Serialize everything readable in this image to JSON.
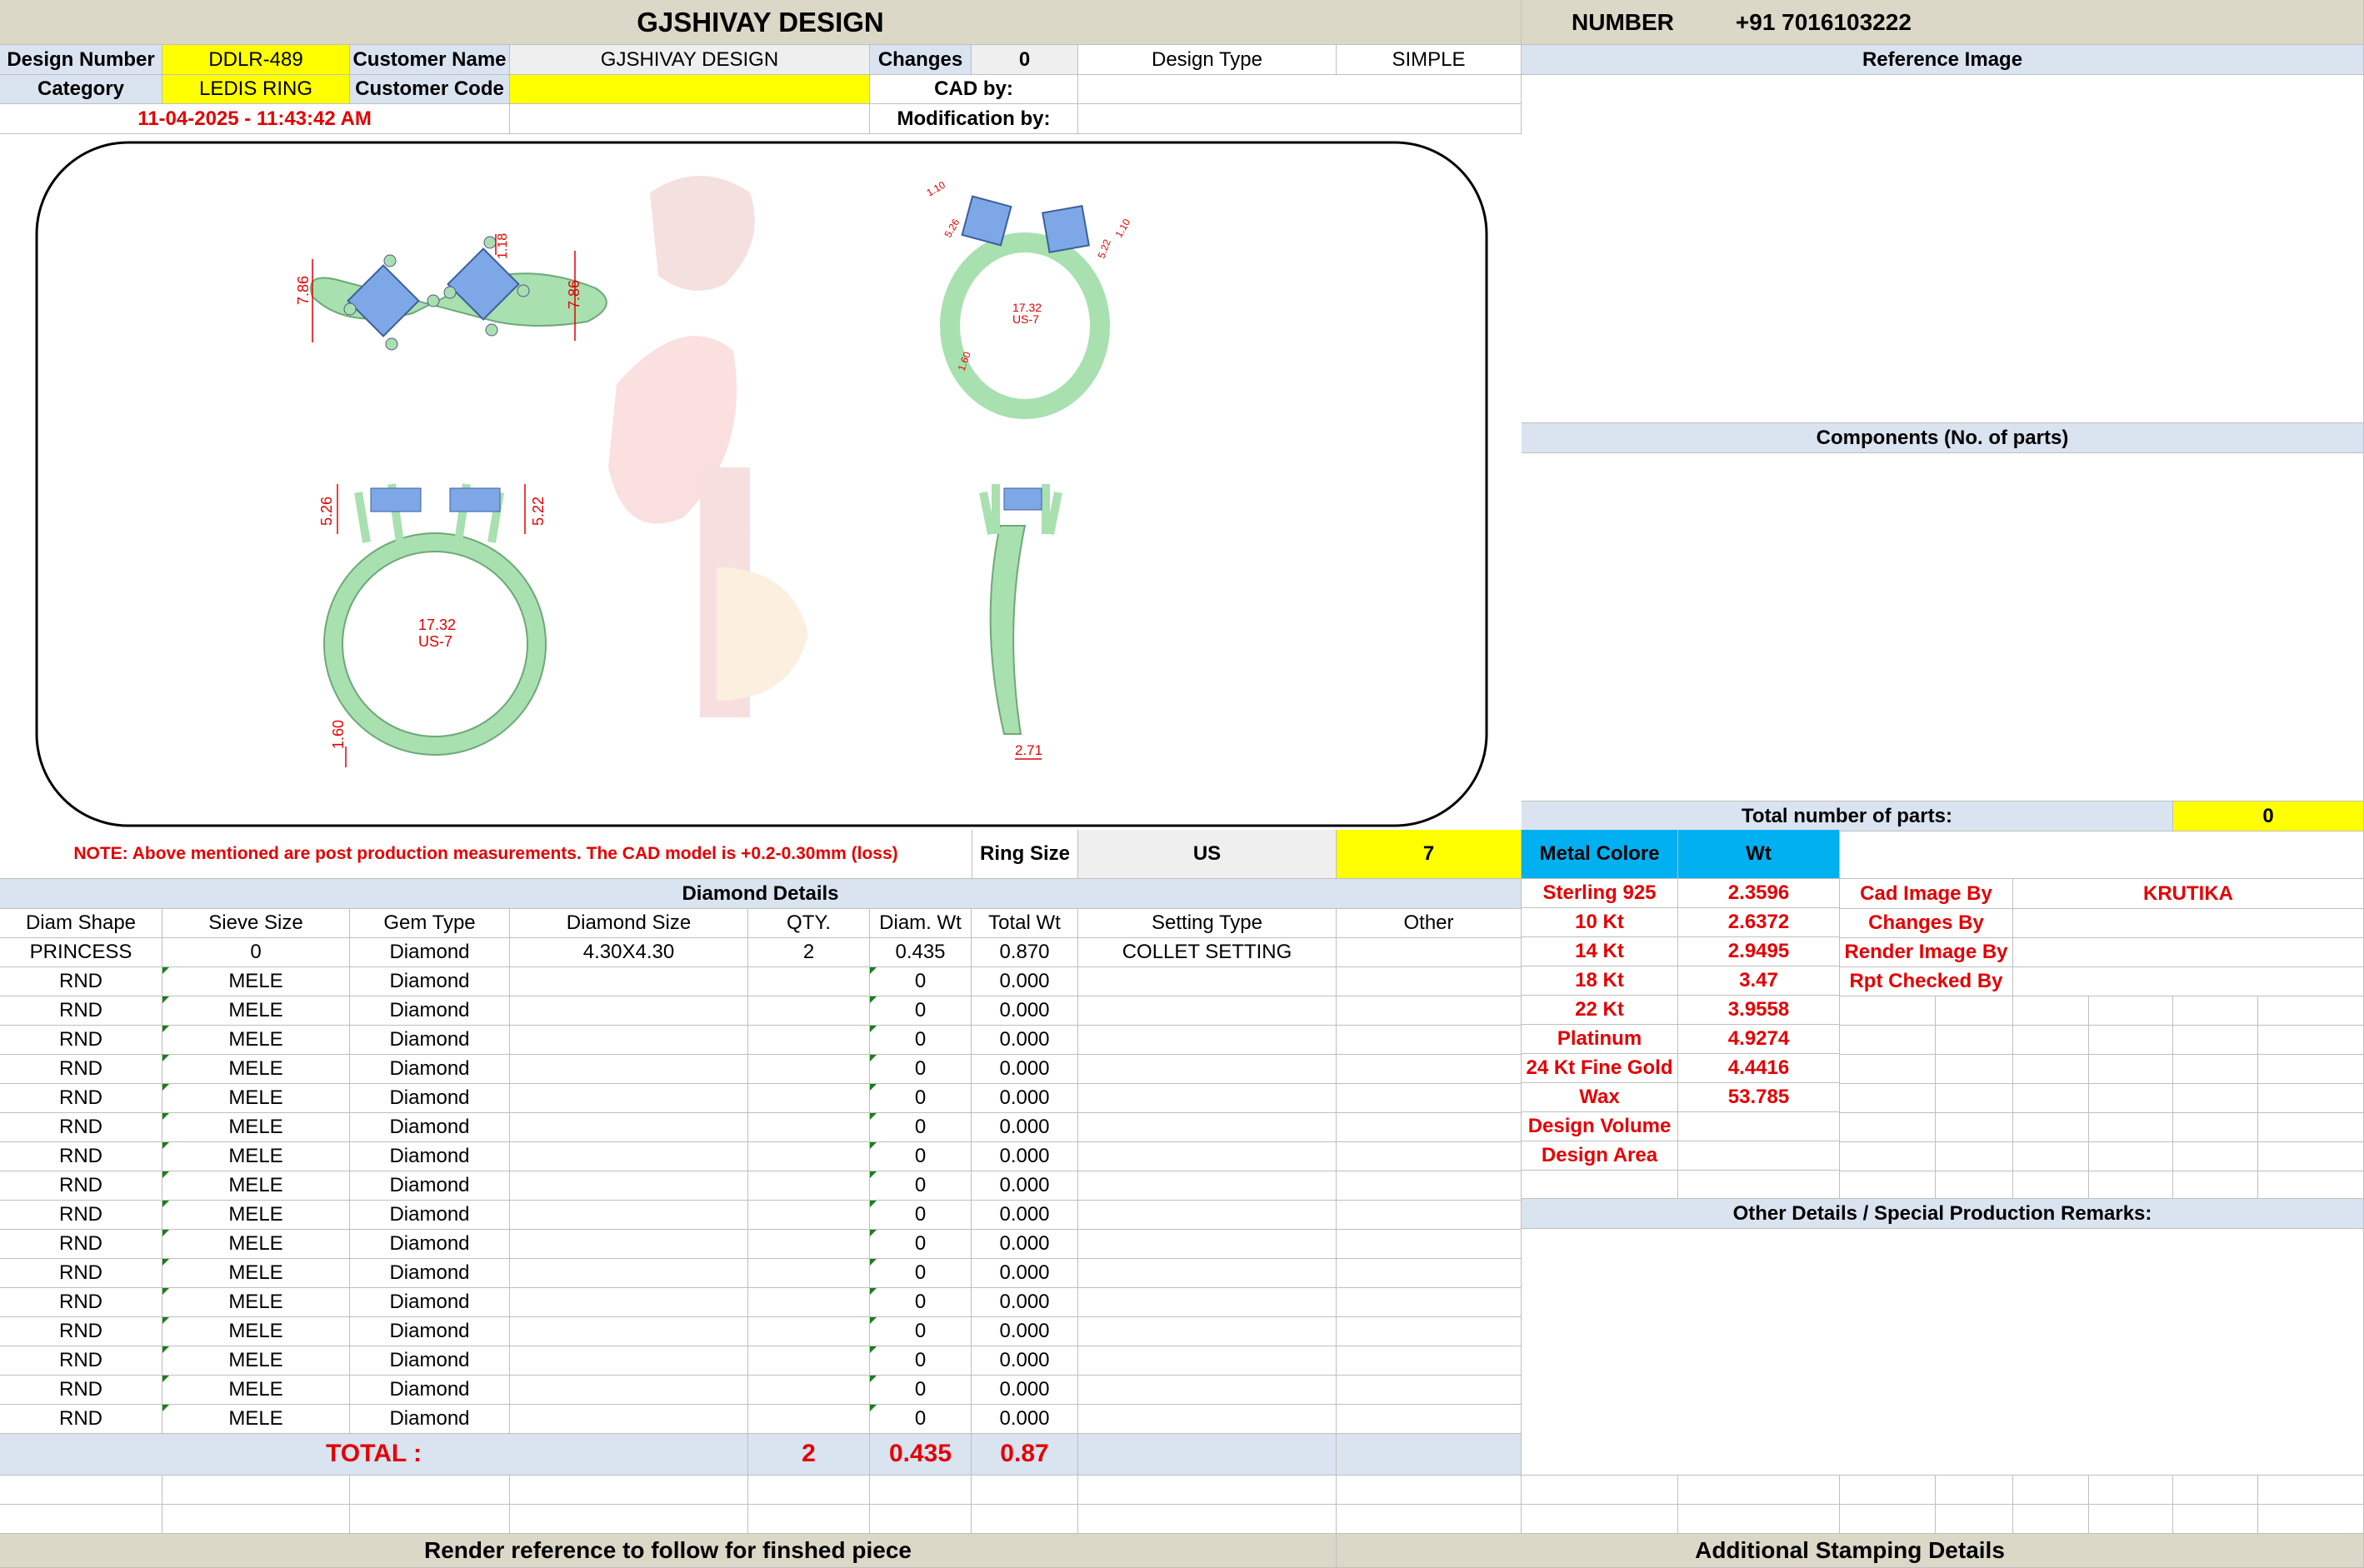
{
  "header": {
    "title": "GJSHIVAY DESIGN",
    "number_label": "NUMBER",
    "number_value": "+91 7016103222"
  },
  "info": {
    "design_number_label": "Design Number",
    "design_number": "DDLR-489",
    "customer_name_label": "Customer Name",
    "customer_name": "GJSHIVAY DESIGN",
    "changes_label": "Changes",
    "changes": "0",
    "design_type_label": "Design Type",
    "design_type": "SIMPLE",
    "category_label": "Category",
    "category": "LEDIS RING",
    "customer_code_label": "Customer Code",
    "customer_code": "",
    "cad_by_label": "CAD by:",
    "datetime": "11-04-2025 - 11:43:42 AM",
    "modification_by_label": "Modification by:"
  },
  "right_panel": {
    "reference_image": "Reference Image",
    "components": "Components (No. of parts)",
    "total_parts_label": "Total number of parts:",
    "total_parts": "0"
  },
  "drawing": {
    "top_left": {
      "width": "7.86",
      "height": "7.86",
      "prong": "1.18"
    },
    "top_right": {
      "d1": "17.32",
      "d2": "US-7",
      "a": "1.10",
      "b": "5.26",
      "c": "5.22",
      "e": "1.10",
      "f": "1.60"
    },
    "front": {
      "inner": "17.32",
      "size": "US-7",
      "left_h": "5.26",
      "right_h": "5.22",
      "bottom": "1.60"
    },
    "side": {
      "width": "2.71"
    }
  },
  "note": {
    "text": "NOTE: Above mentioned are post production measurements. The CAD model is +0.2-0.30mm (loss)",
    "ring_size_label": "Ring Size",
    "ring_size_unit": "US",
    "ring_size": "7"
  },
  "metal": {
    "label": "Metal Colore",
    "wt_label": "Wt",
    "rows": [
      {
        "name": "Sterling 925",
        "wt": "2.3596"
      },
      {
        "name": "10 Kt",
        "wt": "2.6372"
      },
      {
        "name": "14 Kt",
        "wt": "2.9495"
      },
      {
        "name": "18 Kt",
        "wt": "3.47"
      },
      {
        "name": "22 Kt",
        "wt": "3.9558"
      },
      {
        "name": "Platinum",
        "wt": "4.9274"
      },
      {
        "name": "24 Kt Fine Gold",
        "wt": "4.4416"
      },
      {
        "name": "Wax",
        "wt": "53.785"
      },
      {
        "name": "Design Volume",
        "wt": ""
      },
      {
        "name": "Design Area",
        "wt": ""
      }
    ]
  },
  "people": {
    "cad_image_by_label": "Cad Image By",
    "cad_image_by": "KRUTIKA",
    "changes_by_label": "Changes By",
    "render_image_by_label": "Render Image By",
    "rpt_checked_by_label": "Rpt Checked By"
  },
  "other_details": "Other Details / Special Production Remarks:",
  "diamond": {
    "title": "Diamond Details",
    "headers": [
      "Diam Shape",
      "Sieve Size",
      "Gem Type",
      "Diamond Size",
      "QTY.",
      "Diam. Wt",
      "Total Wt",
      "Setting Type",
      "Other"
    ],
    "rows": [
      [
        "PRINCESS",
        "0",
        "Diamond",
        "4.30X4.30",
        "2",
        "0.435",
        "0.870",
        "COLLET SETTING",
        ""
      ],
      [
        "RND",
        "MELE",
        "Diamond",
        "",
        "",
        "0",
        "0.000",
        "",
        ""
      ],
      [
        "RND",
        "MELE",
        "Diamond",
        "",
        "",
        "0",
        "0.000",
        "",
        ""
      ],
      [
        "RND",
        "MELE",
        "Diamond",
        "",
        "",
        "0",
        "0.000",
        "",
        ""
      ],
      [
        "RND",
        "MELE",
        "Diamond",
        "",
        "",
        "0",
        "0.000",
        "",
        ""
      ],
      [
        "RND",
        "MELE",
        "Diamond",
        "",
        "",
        "0",
        "0.000",
        "",
        ""
      ],
      [
        "RND",
        "MELE",
        "Diamond",
        "",
        "",
        "0",
        "0.000",
        "",
        ""
      ],
      [
        "RND",
        "MELE",
        "Diamond",
        "",
        "",
        "0",
        "0.000",
        "",
        ""
      ],
      [
        "RND",
        "MELE",
        "Diamond",
        "",
        "",
        "0",
        "0.000",
        "",
        ""
      ],
      [
        "RND",
        "MELE",
        "Diamond",
        "",
        "",
        "0",
        "0.000",
        "",
        ""
      ],
      [
        "RND",
        "MELE",
        "Diamond",
        "",
        "",
        "0",
        "0.000",
        "",
        ""
      ],
      [
        "RND",
        "MELE",
        "Diamond",
        "",
        "",
        "0",
        "0.000",
        "",
        ""
      ],
      [
        "RND",
        "MELE",
        "Diamond",
        "",
        "",
        "0",
        "0.000",
        "",
        ""
      ],
      [
        "RND",
        "MELE",
        "Diamond",
        "",
        "",
        "0",
        "0.000",
        "",
        ""
      ],
      [
        "RND",
        "MELE",
        "Diamond",
        "",
        "",
        "0",
        "0.000",
        "",
        ""
      ],
      [
        "RND",
        "MELE",
        "Diamond",
        "",
        "",
        "0",
        "0.000",
        "",
        ""
      ],
      [
        "RND",
        "MELE",
        "Diamond",
        "",
        "",
        "0",
        "0.000",
        "",
        ""
      ]
    ],
    "total_label": "TOTAL :",
    "total_qty": "2",
    "total_diam_wt": "0.435",
    "total_wt": "0.87"
  },
  "footer": {
    "render_reference": "Render reference to follow for finshed piece",
    "stamping": "Additional Stamping Details"
  },
  "colors": {
    "header_bg": "#dcd8c8",
    "blue_bg": "#dae3f0",
    "yellow": "#ffff00",
    "cyan": "#00b0f0",
    "red_text": "#e40000",
    "ring_green": "#a8e0b0",
    "stone_blue": "#7ea7e8"
  }
}
